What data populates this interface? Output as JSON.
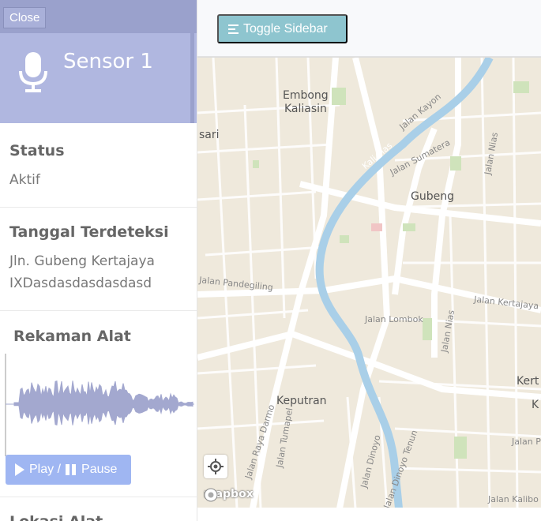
{
  "sidebar": {
    "close_label": "Close",
    "sensor_title": "Sensor 1",
    "status": {
      "title": "Status",
      "value": "Aktif"
    },
    "tanggal": {
      "title": "Tanggal Terdeteksi",
      "line1": "Jln. Gubeng Kertajaya",
      "line2": "IXDasdasdasdasdasd"
    },
    "rekaman": {
      "title": "Rekaman Alat",
      "play_label": "Play / ",
      "pause_label": "Pause"
    },
    "lokasi": {
      "title": "Lokasi Alat"
    }
  },
  "header": {
    "toggle_label": "Toggle Sidebar"
  },
  "map": {
    "labels": {
      "embong": "Embong",
      "kaliasin": "Kaliasin",
      "sari": "sari",
      "gubeng": "Gubeng",
      "keputran": "Keputran",
      "kert": "Kert",
      "k": "K",
      "jalan_kayon": "Jalan Kayon",
      "jalan_sumatera": "Jalan Sumatera",
      "jalan_nias": "Jalan Nias",
      "jalan_nias2": "Jalan Nias",
      "jalan_pandegiling": "Jalan Pandegiling",
      "jalan_kertajaya": "Jalan Kertajaya",
      "jalan_lombok": "Jalan Lombok",
      "jalan_raya_darmo": "Jalan Raya Darmo",
      "jalan_tumapel": "Jalan Tumapel",
      "jalan_dinoyo": "Jalan Dinoyo",
      "jalan_dinoyo_tenun": "Jalan Dinoyo Tenun",
      "jalan_kalibo": "Jalan Kalibo",
      "jalan_pa": "Jalan Pa",
      "kali_mas": "Kali Mas",
      "mapbox": "mapbox"
    }
  },
  "colors": {
    "header": "#b0b7e0",
    "button": "#9fb6f2",
    "toggle": "#8ec5cf",
    "river": "#a9cfe8",
    "map_bg": "#efe9dc"
  }
}
